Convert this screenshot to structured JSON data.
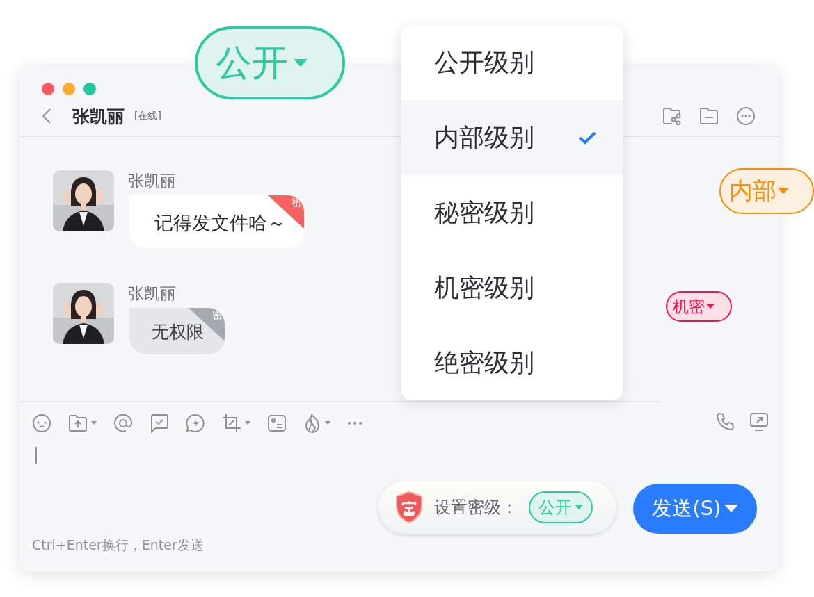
{
  "header": {
    "title": "张凯丽",
    "status": "[在线]"
  },
  "messages": [
    {
      "sender": "张凯丽",
      "text": "记得发文件哈～",
      "kind": "readable",
      "badge": "密"
    },
    {
      "sender": "张凯丽",
      "text": "无权限",
      "kind": "locked",
      "badge": "密"
    }
  ],
  "composer": {
    "hint": "Ctrl+Enter换行，Enter发送"
  },
  "security": {
    "label": "设置密级：",
    "level": "公开"
  },
  "send_button": "发送(S)",
  "floating_tags": [
    {
      "text": "公开",
      "kind": "large",
      "color": "#2cc9a4"
    },
    {
      "text": "内部",
      "kind": "medium",
      "color": "#ff8c00"
    },
    {
      "text": "机密",
      "kind": "small",
      "color": "#f5134f"
    }
  ],
  "dropdown": {
    "items": [
      {
        "label": "公开级别",
        "selected": false
      },
      {
        "label": "内部级别",
        "selected": true
      },
      {
        "label": "秘密级别",
        "selected": false
      },
      {
        "label": "机密级别",
        "selected": false
      },
      {
        "label": "绝密级别",
        "selected": false
      }
    ]
  }
}
